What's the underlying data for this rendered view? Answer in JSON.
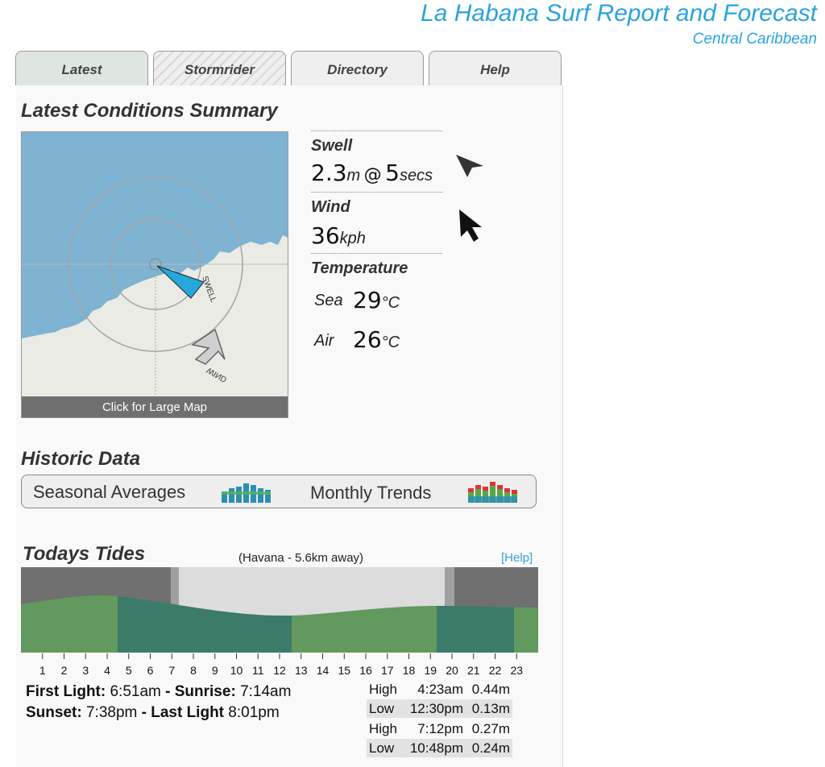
{
  "header": {
    "title": "La Habana Surf Report and Forecast",
    "subtitle": "Central Caribbean"
  },
  "tabs": [
    {
      "label": "Latest",
      "active": true
    },
    {
      "label": "Stormrider",
      "active": false
    },
    {
      "label": "Directory",
      "active": false
    },
    {
      "label": "Help",
      "active": false
    }
  ],
  "conditions": {
    "heading": "Latest Conditions Summary",
    "map": {
      "link_label": "Click for Large Map",
      "swell_arrow_label": "SWELL",
      "wind_arrow_label": "WIND"
    },
    "swell": {
      "label": "Swell",
      "height": "2.3",
      "height_unit": "m",
      "at": "@",
      "period": "5",
      "period_unit": "secs"
    },
    "wind": {
      "label": "Wind",
      "speed": "36",
      "unit": "kph"
    },
    "temperature": {
      "label": "Temperature",
      "sea_label": "Sea",
      "sea_value": "29",
      "sea_unit": "°C",
      "air_label": "Air",
      "air_value": "26",
      "air_unit": "°C"
    }
  },
  "historic": {
    "heading": "Historic Data",
    "seasonal_label": "Seasonal Averages",
    "monthly_label": "Monthly Trends"
  },
  "tides": {
    "heading": "Todays Tides",
    "location": "(Havana - 5.6km away)",
    "help_label": "[Help]",
    "hours": [
      "1",
      "2",
      "3",
      "4",
      "5",
      "6",
      "7",
      "8",
      "9",
      "10",
      "11",
      "12",
      "13",
      "14",
      "15",
      "16",
      "17",
      "18",
      "19",
      "20",
      "21",
      "22",
      "23"
    ],
    "sun": {
      "first_light_label": "First Light:",
      "first_light": "6:51am",
      "sunrise_label": "Sunrise:",
      "sunrise": "7:14am",
      "sunset_label": "Sunset:",
      "sunset": "7:38pm",
      "last_light_label": "Last Light",
      "last_light": "8:01pm",
      "sep": "-"
    },
    "table": [
      {
        "type": "High",
        "time": "4:23am",
        "height": "0.44m"
      },
      {
        "type": "Low",
        "time": "12:30pm",
        "height": "0.13m"
      },
      {
        "type": "High",
        "time": "7:12pm",
        "height": "0.27m"
      },
      {
        "type": "Low",
        "time": "10:48pm",
        "height": "0.24m"
      }
    ]
  }
}
